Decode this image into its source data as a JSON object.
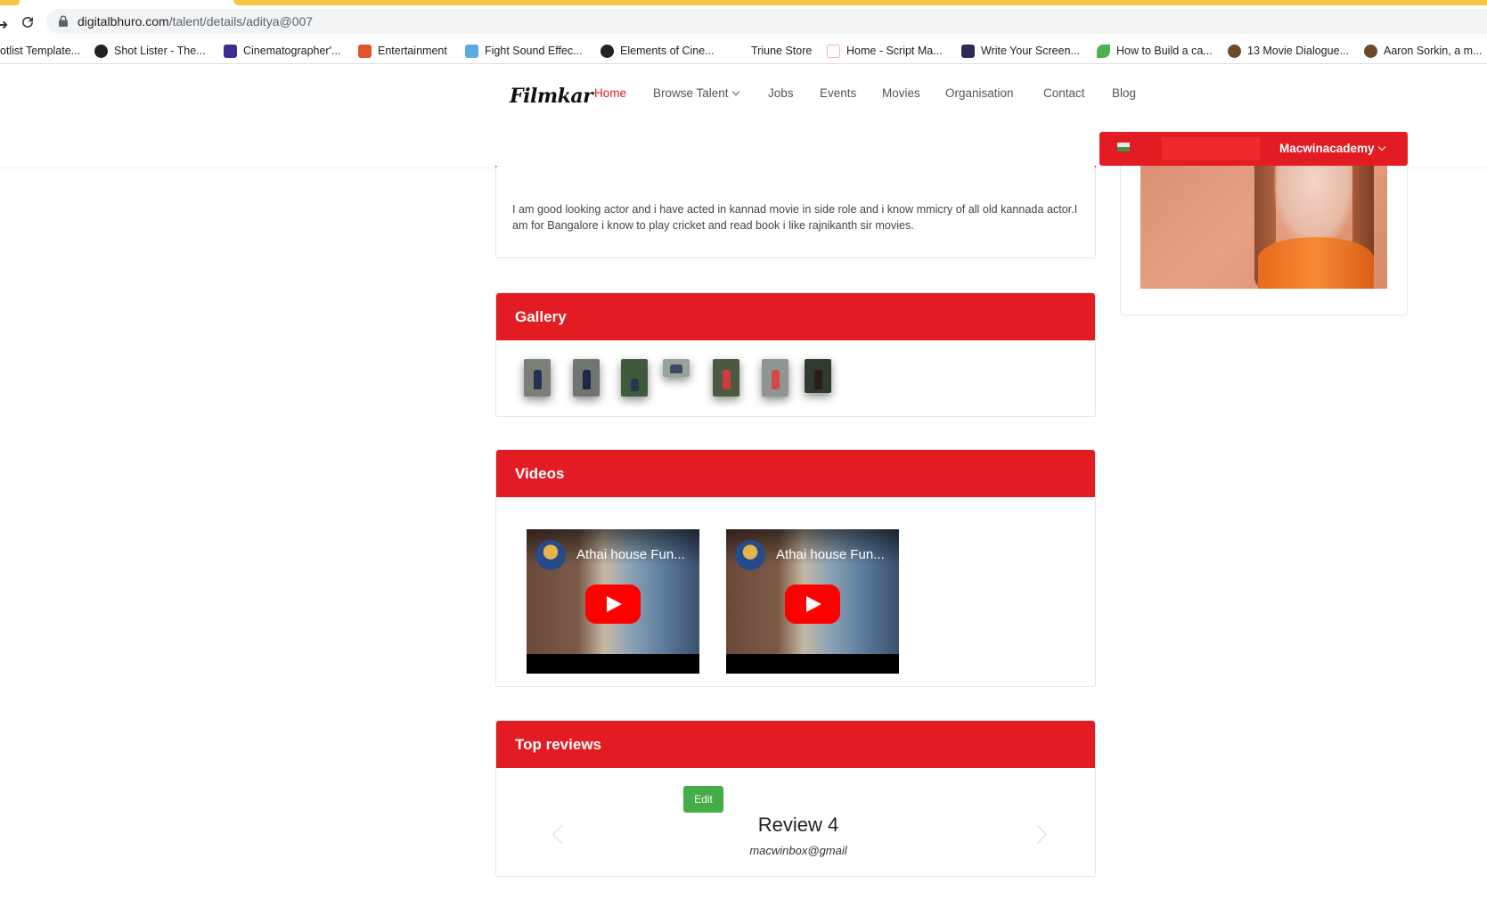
{
  "browser": {
    "url_host": "digitalbhuro.com",
    "url_path": "/talent/details/aditya@007",
    "bookmarks": [
      {
        "label": "otlist Template...",
        "icon": "page-icon",
        "color": "#ffffff"
      },
      {
        "label": "Shot Lister - The...",
        "icon": "globe-icon",
        "color": "#222222"
      },
      {
        "label": "Cinematographer'...",
        "icon": "film-icon",
        "color": "#3b2e8f"
      },
      {
        "label": "Entertainment",
        "icon": "s-icon",
        "color": "#e0532b"
      },
      {
        "label": "Fight Sound Effec...",
        "icon": "g-icon",
        "color": "#5aa9e0"
      },
      {
        "label": "Elements of Cine...",
        "icon": "globe-icon",
        "color": "#222222"
      },
      {
        "label": "Triune Store",
        "icon": "blank-icon",
        "color": "#ffffff"
      },
      {
        "label": "Home - Script Ma...",
        "icon": "script-icon",
        "color": "#e31b23"
      },
      {
        "label": "Write Your Screen...",
        "icon": "square-icon",
        "color": "#2b2b55"
      },
      {
        "label": "How to Build a ca...",
        "icon": "leaf-icon",
        "color": "#4caf50"
      },
      {
        "label": "13 Movie Dialogue...",
        "icon": "owl-icon",
        "color": "#6b4b2a"
      },
      {
        "label": "Aaron Sorkin, a m...",
        "icon": "owl-icon",
        "color": "#6b4b2a"
      }
    ]
  },
  "site": {
    "logo": "Filmkar",
    "nav": [
      {
        "label": "Home",
        "active": true
      },
      {
        "label": "Browse Talent",
        "dropdown": true
      },
      {
        "label": "Jobs"
      },
      {
        "label": "Events"
      },
      {
        "label": "Movies"
      },
      {
        "label": "Organisation"
      },
      {
        "label": "Contact"
      },
      {
        "label": "Blog"
      }
    ],
    "user": {
      "name": "Macwinacademy",
      "accent": "#e31b23"
    }
  },
  "about": {
    "text": "I am good looking actor and i have acted in kannad movie in side role and i know mmicry of all old kannada actor.I am for Bangalore i know to play cricket and read book i like rajnikanth sir movies."
  },
  "gallery": {
    "title": "Gallery",
    "thumbnails": [
      {
        "bg": "#7a7f78",
        "fig": "#23324f"
      },
      {
        "bg": "#6f7670",
        "fig": "#1c2a45"
      },
      {
        "bg": "#3f5a3a",
        "fig": "#2a3550"
      },
      {
        "bg": "#9aa39a",
        "fig": "#3a4a6a"
      },
      {
        "bg": "#4a5a40",
        "fig": "#d23b3b"
      },
      {
        "bg": "#8f9590",
        "fig": "#d44a4a"
      },
      {
        "bg": "#2f3a30",
        "fig": "#2a1f18"
      }
    ]
  },
  "videos": {
    "title": "Videos",
    "items": [
      {
        "title": "Athai house Fun..."
      },
      {
        "title": "Athai house Fun..."
      }
    ]
  },
  "reviews": {
    "title": "Top reviews",
    "edit_label": "Edit",
    "review_title": "Review 4",
    "review_author": "macwinbox@gmail"
  }
}
